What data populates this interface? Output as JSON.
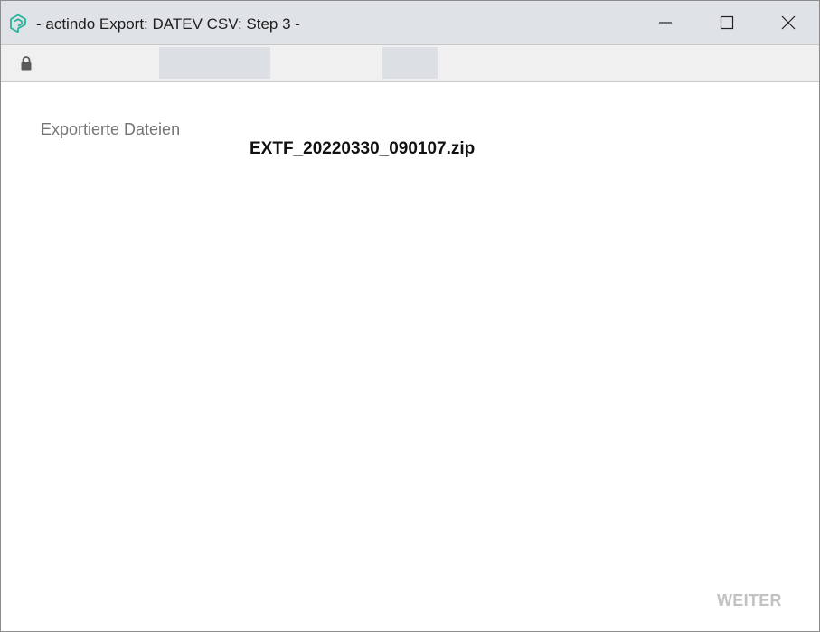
{
  "window": {
    "title": "- actindo Export: DATEV CSV: Step 3 -",
    "app_icon": "actindo-logo-icon",
    "controls": [
      "minimize-icon",
      "maximize-icon",
      "close-icon"
    ]
  },
  "addressbar": {
    "security_icon": "lock-icon"
  },
  "main": {
    "section_label": "Exportierte Dateien",
    "files": [
      "EXTF_20220330_090107.zip"
    ],
    "next_button_label": "WEITER",
    "next_button_enabled": false
  },
  "colors": {
    "titlebar_bg": "#dfe2e6",
    "addressbar_bg": "#f0f0f0",
    "logo_accent": "#2bb39a",
    "disabled_text": "#c2c2c2"
  }
}
